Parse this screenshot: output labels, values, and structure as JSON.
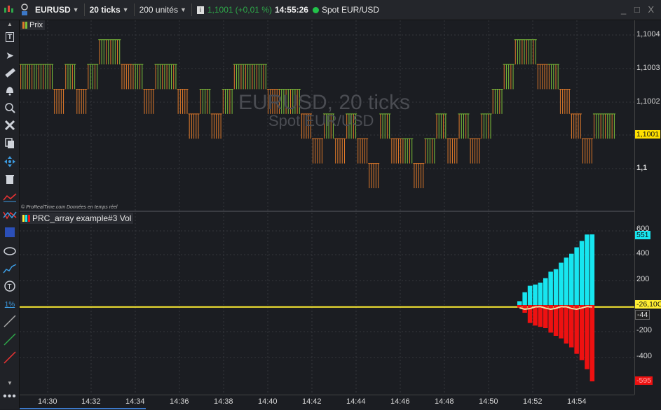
{
  "toolbar": {
    "symbol": "EURUSD",
    "timeframe": "20 ticks",
    "units": "200 unités",
    "last_price": "1,1001",
    "change": "(+0,01 %)",
    "time": "14:55:26",
    "instrument": "Spot EUR/USD",
    "window_controls": "_ □ X"
  },
  "price_panel": {
    "legend": "Prix",
    "watermark_title": "EURUSD, 20 ticks",
    "watermark_sub": "Spot EUR/USD",
    "credit": "© ProRealTime.com  Données en temps réel",
    "y_labels": [
      "1,1004",
      "1,1003",
      "1,1002",
      "1,1001",
      "1,1"
    ],
    "current_price_label": "1,1001"
  },
  "indicator_panel": {
    "legend": "PRC_array example#3 Vol",
    "y_labels": [
      "600",
      "400",
      "200",
      "-200",
      "-400"
    ],
    "badge_top": "551",
    "badge_line": "-26,10C",
    "badge_mid": "-44",
    "badge_bottom": "-595"
  },
  "x_labels": [
    "14:30",
    "14:32",
    "14:34",
    "14:36",
    "14:38",
    "14:40",
    "14:42",
    "14:44",
    "14:46",
    "14:48",
    "14:50",
    "14:52",
    "14:54"
  ],
  "colors": {
    "up": "#7cbf3a",
    "down": "#e07a2a",
    "cyan": "#17e6f0",
    "red": "#ee1111",
    "yellow": "#ffee33"
  },
  "chart_data": [
    {
      "type": "line",
      "title": "EURUSD, 20 ticks",
      "ylim": [
        1.0998,
        1.10045
      ],
      "values": [
        1.1003,
        1.1003,
        1.1003,
        1.1002,
        1.1003,
        1.1002,
        1.1003,
        1.1004,
        1.1004,
        1.1003,
        1.1003,
        1.1002,
        1.1003,
        1.1003,
        1.1002,
        1.1001,
        1.1002,
        1.1001,
        1.1002,
        1.1003,
        1.1003,
        1.1003,
        1.1002,
        1.1002,
        1.1002,
        1.1001,
        1.1,
        1.1001,
        1.1,
        1.1001,
        1.1,
        1.0999,
        1.1001,
        1.1,
        1.1,
        1.0999,
        1.1,
        1.1001,
        1.1,
        1.1001,
        1.1,
        1.1001,
        1.1002,
        1.1003,
        1.1004,
        1.1004,
        1.1003,
        1.1003,
        1.1002,
        1.1001,
        1.1,
        1.1001,
        1.1001
      ]
    },
    {
      "type": "bar",
      "title": "PRC_array example#3 Vol",
      "ylim": [
        -640,
        640
      ],
      "positive": [
        30,
        100,
        150,
        160,
        175,
        210,
        260,
        280,
        330,
        370,
        400,
        450,
        500,
        550,
        551
      ],
      "negative": [
        -20,
        -60,
        -140,
        -160,
        -170,
        -180,
        -215,
        -240,
        -260,
        -300,
        -330,
        -380,
        -430,
        -500,
        -595
      ],
      "line_value": -26.1
    }
  ]
}
